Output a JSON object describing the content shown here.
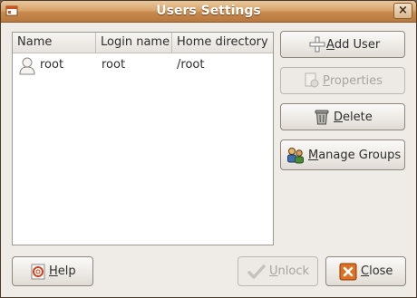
{
  "window": {
    "title": "Users Settings"
  },
  "user_list": {
    "columns": [
      "Name",
      "Login name",
      "Home directory"
    ],
    "rows": [
      {
        "name": "root",
        "login": "root",
        "home": "/root",
        "icon": "user-icon"
      }
    ]
  },
  "side_buttons": {
    "add_user": {
      "mnemonic": "A",
      "rest": "dd User",
      "icon": "add-icon",
      "enabled": true
    },
    "properties": {
      "mnemonic": "P",
      "rest": "roperties",
      "icon": "properties-icon",
      "enabled": false
    },
    "delete": {
      "mnemonic": "D",
      "rest": "elete",
      "icon": "trash-icon",
      "enabled": true
    },
    "manage_groups": {
      "mnemonic": "M",
      "rest": "anage Groups",
      "icon": "groups-icon",
      "enabled": true
    }
  },
  "bottom_buttons": {
    "help": {
      "mnemonic": "H",
      "rest": "elp",
      "icon": "help-icon",
      "enabled": true
    },
    "unlock": {
      "mnemonic": "U",
      "rest": "nlock",
      "icon": "check-icon",
      "enabled": false
    },
    "close": {
      "mnemonic": "C",
      "rest": "lose",
      "icon": "close-icon",
      "enabled": true
    }
  },
  "colors": {
    "titlebar": "#d9a46b",
    "close_icon": "#e0701f"
  }
}
